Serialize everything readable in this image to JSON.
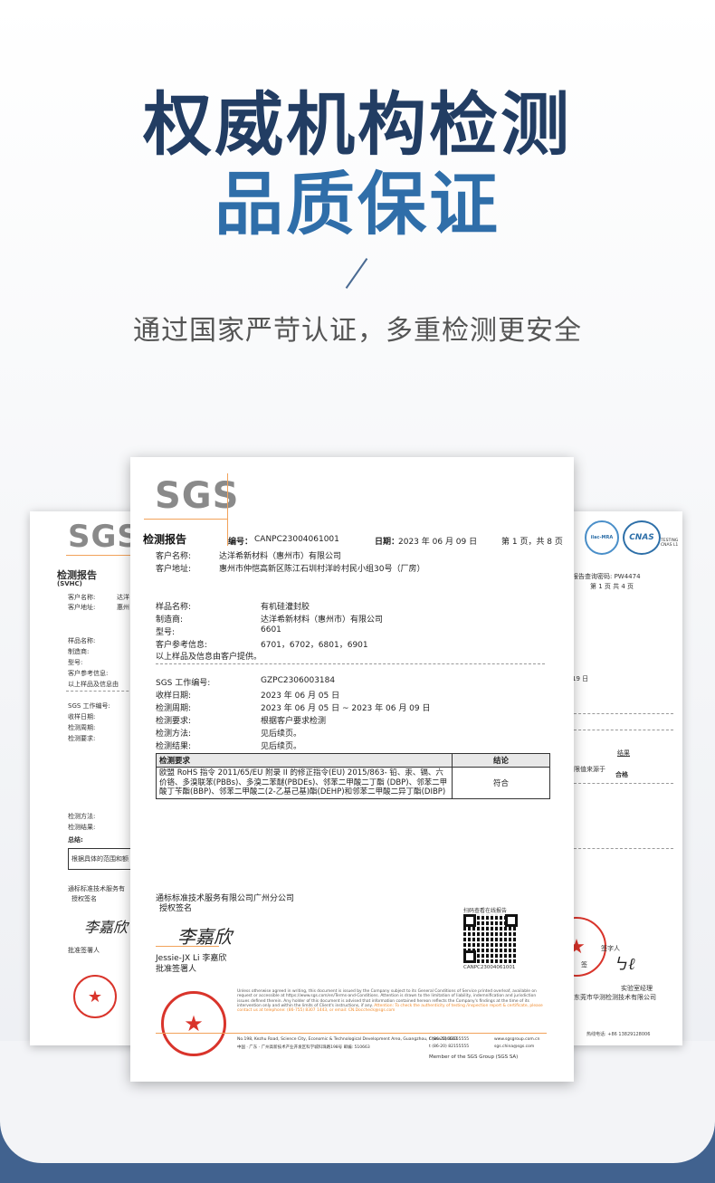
{
  "header": {
    "title_line1": "权威机构检测",
    "title_line2": "品质保证",
    "subtitle": "通过国家严苛认证，多重检测更安全"
  },
  "colors": {
    "title_dark": "#223d63",
    "title_blue": "#2f6ea9",
    "band": "#41628f",
    "sgs_orange": "#f2a25a",
    "stamp_red": "#d9342b"
  },
  "main_doc": {
    "logo": "SGS",
    "report_title": "检测报告",
    "number_label": "编号：",
    "number": "CANPC23004061001",
    "date_label": "日期：",
    "date": "2023 年 06 月 09 日",
    "page_info": "第 1 页，共 8 页",
    "client_name_label": "客户名称:",
    "client_name": "达洋希新材料（惠州市）有限公司",
    "client_address_label": "客户地址:",
    "client_address": "惠州市仲恺高新区陈江石圳村洋岭村民小组30号（厂房）",
    "sample_name_label": "样品名称:",
    "sample_name": "有机硅灌封胶",
    "manufacturer_label": "制造商:",
    "manufacturer": "达洋希新材料（惠州市）有限公司",
    "model_label": "型号:",
    "model": "6601",
    "ref_label": "客户参考信息:",
    "ref": "6701，6702，6801，6901",
    "provided_note": "以上样品及信息由客户提供。",
    "sgs_job_label": "SGS 工作编号:",
    "sgs_job": "GZPC2306003184",
    "received_label": "收样日期:",
    "received": "2023 年 06 月 05 日",
    "period_label": "检测周期:",
    "period": "2023 年 06 月 05 日 ~ 2023 年 06 月 09 日",
    "request_label": "检测要求:",
    "request": "根据客户要求检测",
    "method_label": "检测方法:",
    "method": "见后续页。",
    "result_label": "检测结果:",
    "result": "见后续页。",
    "table_header_req": "检测要求",
    "table_header_conclusion": "结论",
    "table_req": "欧盟 RoHS 指令 2011/65/EU 附录 II 的修正指令(EU) 2015/863- 铅、汞、镉、六价铬、多溴联苯(PBBs)、多溴二苯醚(PBDEs)、邻苯二甲酸二丁酯 (DBP)、邻苯二甲酸丁苄酯(BBP)、邻苯二甲酸二(2-乙基己基)酯(DEHP)和邻苯二甲酸二异丁酯(DIBP)",
    "table_conclusion": "符合",
    "company": "通标标准技术服务有限公司广州分公司",
    "authorized": "授权签名",
    "signature": "李嘉欣",
    "signer": "Jessie-JX Li 李嘉欣",
    "signer_role": "批准签署人",
    "qr_caption": "扫码查看在线报告",
    "qr_number": "CANPC23004061001",
    "fineprint": "Unless otherwise agreed in writing, this document is issued by the Company subject to its General Conditions of Service printed overleaf, available on request or accessible at https://www.sgs.com/en/Terms-and-Conditions. Attention is drawn to the limitation of liability, indemnification and jurisdiction issues defined therein. Any holder of this document is advised that information contained hereon reflects the Company's findings at the time of its intervention only and within the limits of Client's instructions, if any.",
    "fineprint_orange": "Attention: To check the authenticity of testing /inspection report & certificate, please contact us at telephone: (86-755) 8307 1443, or email: CN.Doccheck@sgs.com",
    "address_line1": "No.198, Kezhu Road, Science City, Economic & Technological Development Area, Guangzhou, China 510663",
    "address_line2": "中国 · 广东 · 广州高新技术产业开发区科学城科珠路198号 邮编: 510663",
    "phone1": "t (86-20) 82155555",
    "phone2": "t (86-20) 82155555",
    "web1": "www.sgsgroup.com.cn",
    "web2": "sgs.china@sgs.com",
    "member": "Member of the SGS Group (SGS SA)",
    "stamp_text": "通标标准技术服务有限公司广州分公司"
  },
  "left_doc": {
    "logo": "SGS",
    "title": "检测报告",
    "subtitle": "(SVHC)",
    "labels": [
      "客户名称:",
      "客户地址:",
      "样品名称:",
      "制造商:",
      "型号:",
      "客户参考信息:",
      "以上样品及信息由",
      "SGS 工作编号:",
      "收样日期:",
      "检测周期:",
      "检测要求:",
      "检测方法:",
      "检测结果:",
      "总结:"
    ],
    "values": [
      "达洋",
      "惠州"
    ],
    "table_text": "根据具体的范围和额",
    "company": "通标标准技术服务有",
    "authorized": "授权签名",
    "signature": "李嘉欣",
    "signer_role": "批准签署人"
  },
  "right_doc": {
    "badges": [
      "ilac-MRA",
      "CNAS"
    ],
    "cnas_caption": "TESTING CNAS L1",
    "query_label": "报告查询密码: PW4474",
    "page": "第 1 页 共 4 页",
    "date_frag": "19 日",
    "result_label": "结果",
    "result_text": "限值来源于",
    "pass": "合格",
    "signer_frag": "签字人",
    "sign_label": "签",
    "role": "实验室经理",
    "company": "东莞市华测检测技术有限公司",
    "phone": "热线电话: +86 13829128006"
  }
}
